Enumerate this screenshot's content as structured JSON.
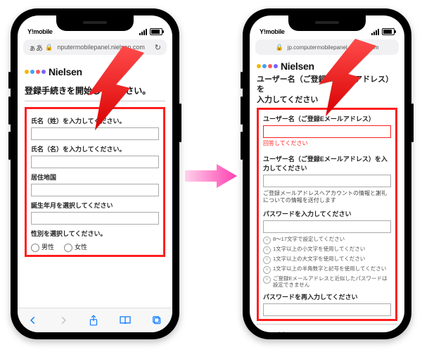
{
  "carrier": "Y!mobile",
  "left": {
    "aa": "ぁあ",
    "url": "nputermobilepanel.nielsen.com",
    "brand": "Nielsen",
    "heading": "登録手続きを開始してください。",
    "labels": {
      "surname": "氏名（姓）を入力してください。",
      "given": "氏名（名）を入力してください。",
      "country": "居住地国",
      "birth": "誕生年月を選択してください",
      "gender": "性別を選択してください。",
      "male": "男性",
      "female": "女性"
    }
  },
  "right": {
    "url": "jp.computermobilepanel.nielsen.com",
    "brand": "Nielsen",
    "heading_l1": "ユーザー名（ご登録Eメールアドレス）を",
    "heading_l2": "入力してください",
    "labels": {
      "username": "ユーザー名（ご登録Eメールアドレス）",
      "answer_required": "回答してください",
      "username2": "ユーザー名（ご登録Eメールアドレス）を入力してください",
      "hint": "ご登録メールアドレスへアカウントの情報と謝礼についての情報を送付します",
      "password": "パスワードを入力してください",
      "password2": "パスワードを再入力してください",
      "rules": [
        "8〜17文字で設定してください",
        "1文字以上の小文字を使用してください",
        "1文字以上の大文字を使用してください",
        "1文字以上の半角数字と記号を使用してください",
        "ご登録Eメールアドレスと近似したパスワードは設定できません"
      ],
      "confirm_section": "本人確認"
    }
  }
}
